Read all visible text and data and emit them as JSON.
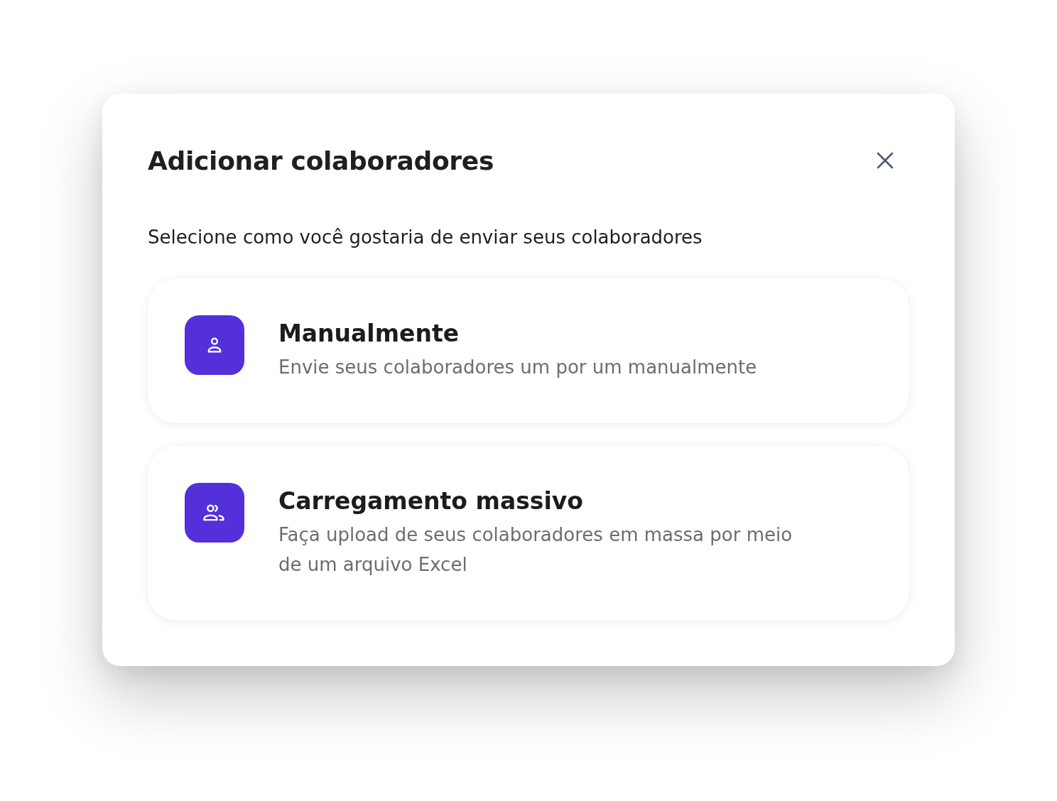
{
  "dialog": {
    "title": "Adicionar colaboradores",
    "prompt": "Selecione como você gostaria de enviar seus colaboradores",
    "options": [
      {
        "kind": "single",
        "title": "Manualmente",
        "description": "Envie seus colaboradores um por um manualmente"
      },
      {
        "kind": "bulk",
        "title": "Carregamento massivo",
        "description": "Faça upload de seus colaboradores em massa por meio de um arquivo Excel"
      }
    ]
  }
}
